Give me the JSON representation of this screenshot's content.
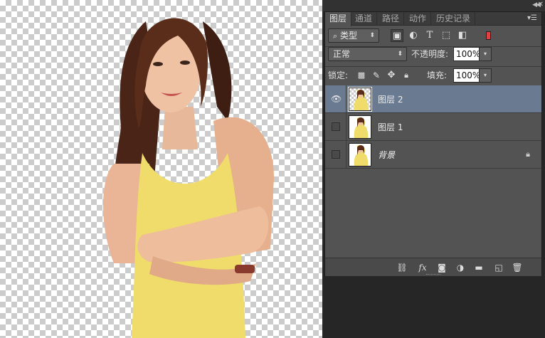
{
  "panel": {
    "tabs": [
      "图层",
      "通道",
      "路径",
      "动作",
      "历史记录"
    ],
    "active_tab": "图层",
    "filter_dropdown": {
      "icon": "search-icon",
      "value": "类型"
    },
    "blend_mode": "正常",
    "opacity_label": "不透明度:",
    "opacity_value": "100%",
    "lock_label": "锁定:",
    "fill_label": "填充:",
    "fill_value": "100%",
    "layers": [
      {
        "name": "图层 2",
        "visible": true,
        "selected": true,
        "transparent_thumb": true,
        "locked": false
      },
      {
        "name": "图层 1",
        "visible": false,
        "selected": false,
        "transparent_thumb": false,
        "locked": false
      },
      {
        "name": "背景",
        "visible": false,
        "selected": false,
        "transparent_thumb": false,
        "locked": true
      }
    ],
    "bottom_icons": [
      "link-layers-icon",
      "fx-icon",
      "add-mask-icon",
      "adjustment-layer-icon",
      "new-group-icon",
      "new-layer-icon",
      "delete-icon"
    ],
    "bottom_fx_label": "fx"
  },
  "colors": {
    "panel_bg": "#535353",
    "selected_row": "#6a7b91",
    "filter_toggle": "#e04040"
  }
}
